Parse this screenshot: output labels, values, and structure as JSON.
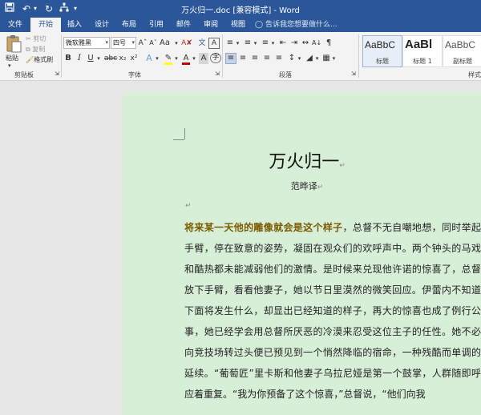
{
  "titlebar": {
    "title": "万火归一.doc [兼容模式] - Word"
  },
  "tabs": [
    {
      "label": "文件"
    },
    {
      "label": "开始"
    },
    {
      "label": "插入"
    },
    {
      "label": "设计"
    },
    {
      "label": "布局"
    },
    {
      "label": "引用"
    },
    {
      "label": "邮件"
    },
    {
      "label": "审阅"
    },
    {
      "label": "视图"
    }
  ],
  "tell_me": "告诉我您想要做什么...",
  "clipboard": {
    "paste": "粘贴",
    "cut": "剪切",
    "copy": "复制",
    "format_painter": "格式刷",
    "label": "剪贴板"
  },
  "font": {
    "name": "微软雅黑",
    "size": "四号",
    "label": "字体",
    "font_color": "#c00000",
    "highlight_color": "#ffff00"
  },
  "paragraph": {
    "label": "段落"
  },
  "styles": {
    "label": "样式",
    "items": [
      {
        "sample": "AaBbC",
        "name": "标题"
      },
      {
        "sample": "AaBl",
        "name": "标题 1"
      },
      {
        "sample": "AaBbC",
        "name": "副标题"
      }
    ]
  },
  "document": {
    "title": "万火归一",
    "author": "范晔译",
    "highlight": "将来某一天他的雕像就会是这个样子",
    "body": "，总督不无自嘲地想，同时举起手臂，停在致意的姿势，凝固在观众们的欢呼声中。两个钟头的马戏和酷热都未能减弱他们的激情。是时候来兑现他许诺的惊喜了，总督放下手臂，看看他妻子，她以节日里漠然的微笑回应。伊蕾内不知道下面将发生什么，却显出已经知道的样子，再大的惊喜也成了例行公事，她已经学会用总督所厌恶的冷漠来忍受这位主子的任性。她不必向竞技场转过头便已预见到一个悄然降临的宿命，一种残酷而单调的延续。“葡萄匠”里卡斯和他妻子乌拉尼娅是第一个鼓掌，人群随即呼应着重复。“我为你预备了这个惊喜，”总督说，“他们向我"
  }
}
